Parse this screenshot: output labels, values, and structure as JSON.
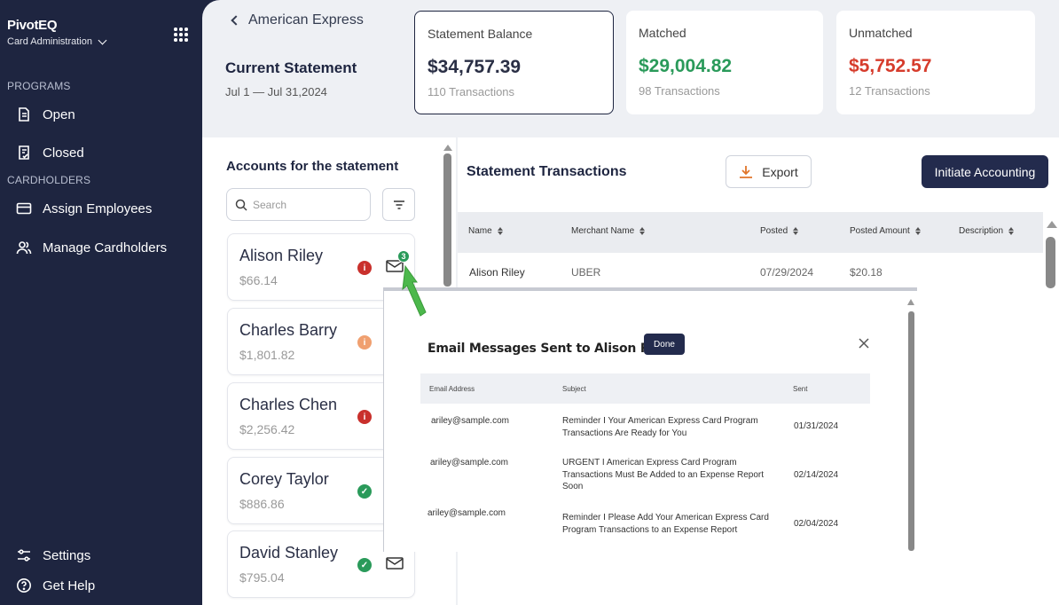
{
  "app": {
    "name": "PivotEQ",
    "subtitle": "Card Administration"
  },
  "sidebar": {
    "programs_label": "PROGRAMS",
    "cardholders_label": "CARDHOLDERS",
    "items": [
      {
        "label": "Open",
        "icon": "document-icon"
      },
      {
        "label": "Closed",
        "icon": "document-check-icon"
      },
      {
        "label": "Assign Employees",
        "icon": "card-icon"
      },
      {
        "label": "Manage Cardholders",
        "icon": "users-icon"
      }
    ],
    "footer": [
      {
        "label": "Settings",
        "icon": "sliders-icon"
      },
      {
        "label": "Get Help",
        "icon": "help-icon"
      }
    ]
  },
  "header": {
    "back_label": "American Express",
    "title": "Current Statement",
    "dates": "Jul 1 — Jul 31,2024"
  },
  "summary": [
    {
      "label": "Statement Balance",
      "value": "$34,757.39",
      "sub": "110 Transactions",
      "color": "#1e2540"
    },
    {
      "label": "Matched",
      "value": "$29,004.82",
      "sub": "98 Transactions",
      "color": "#2a9a5a"
    },
    {
      "label": "Unmatched",
      "value": "$5,752.57",
      "sub": "12 Transactions",
      "color": "#d63c2c"
    }
  ],
  "accounts": {
    "title": "Accounts for the statement",
    "search_placeholder": "Search",
    "list": [
      {
        "name": "Alison Riley",
        "amount": "$66.14",
        "status": "error",
        "badge": "3"
      },
      {
        "name": "Charles Barry",
        "amount": "$1,801.82",
        "status": "warning"
      },
      {
        "name": "Charles Chen",
        "amount": "$2,256.42",
        "status": "error"
      },
      {
        "name": "Corey Taylor",
        "amount": "$886.86",
        "status": "ok"
      },
      {
        "name": "David Stanley",
        "amount": "$795.04",
        "status": "ok"
      }
    ]
  },
  "transactions": {
    "title": "Statement Transactions",
    "export_label": "Export",
    "initiate_label": "Initiate Accounting",
    "columns": [
      "Name",
      "Merchant Name",
      "Posted",
      "Posted Amount",
      "Description"
    ],
    "rows": [
      {
        "name": "Alison Riley",
        "merchant": "UBER",
        "posted": "07/29/2024",
        "amount": "$20.18",
        "description": ""
      }
    ]
  },
  "popup": {
    "title": "Email Messages Sent to Alison Riley",
    "done_label": "Done",
    "columns": [
      "Email Address",
      "Subject",
      "Sent"
    ],
    "rows": [
      {
        "email": "ariley@sample.com",
        "subject": "Reminder I Your American Express Card Program Transactions Are Ready for You",
        "sent": "01/31/2024"
      },
      {
        "email": "ariley@sample.com",
        "subject": "URGENT I American Express Card Program Transactions Must Be Added to an Expense Report Soon",
        "sent": "02/14/2024"
      },
      {
        "email": "ariley@sample.com",
        "subject": "Reminder I Please Add Your American Express Card Program Transactions to an Expense Report",
        "sent": "02/04/2024"
      }
    ]
  },
  "colors": {
    "navy": "#1e2540",
    "green": "#2a9a5a",
    "red": "#d63c2c",
    "orange": "#f0a070"
  }
}
